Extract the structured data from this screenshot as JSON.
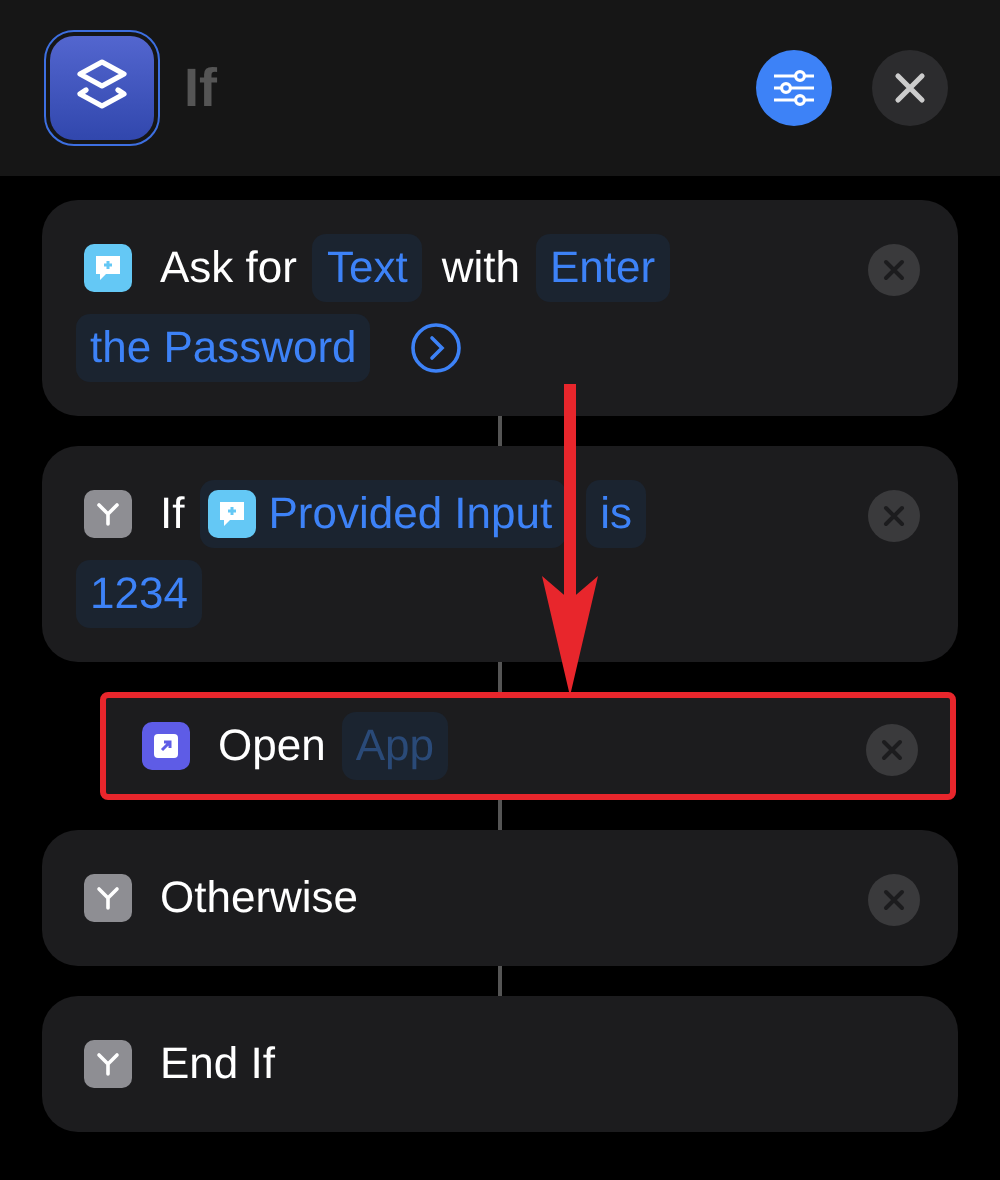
{
  "header": {
    "title": "If"
  },
  "pointer_arrow": true,
  "actions": [
    {
      "kind": "ask_for_input",
      "removable": true,
      "highlighted": false,
      "parts": [
        {
          "kind": "word",
          "text": "Ask for"
        },
        {
          "kind": "variable",
          "text": "Text"
        },
        {
          "kind": "word",
          "text": "with"
        },
        {
          "kind": "variable",
          "text": "Enter"
        },
        {
          "kind": "variable",
          "text": "the Password"
        },
        {
          "kind": "expand"
        }
      ]
    },
    {
      "kind": "conditional",
      "removable": true,
      "highlighted": false,
      "parts": [
        {
          "kind": "word",
          "text": "If"
        },
        {
          "kind": "magic_variable",
          "text": "Provided Input"
        },
        {
          "kind": "variable",
          "text": "is"
        },
        {
          "kind": "variable",
          "text": "1234"
        }
      ],
      "children": [
        {
          "kind": "open_app",
          "removable": true,
          "highlighted": true,
          "parts": [
            {
              "kind": "word",
              "text": "Open"
            },
            {
              "kind": "placeholder",
              "text": "App"
            }
          ]
        }
      ]
    },
    {
      "kind": "conditional",
      "removable": true,
      "highlighted": false,
      "parts": [
        {
          "kind": "word",
          "text": "Otherwise"
        }
      ]
    },
    {
      "kind": "conditional",
      "removable": false,
      "highlighted": false,
      "parts": [
        {
          "kind": "word",
          "text": "End If"
        }
      ]
    }
  ]
}
